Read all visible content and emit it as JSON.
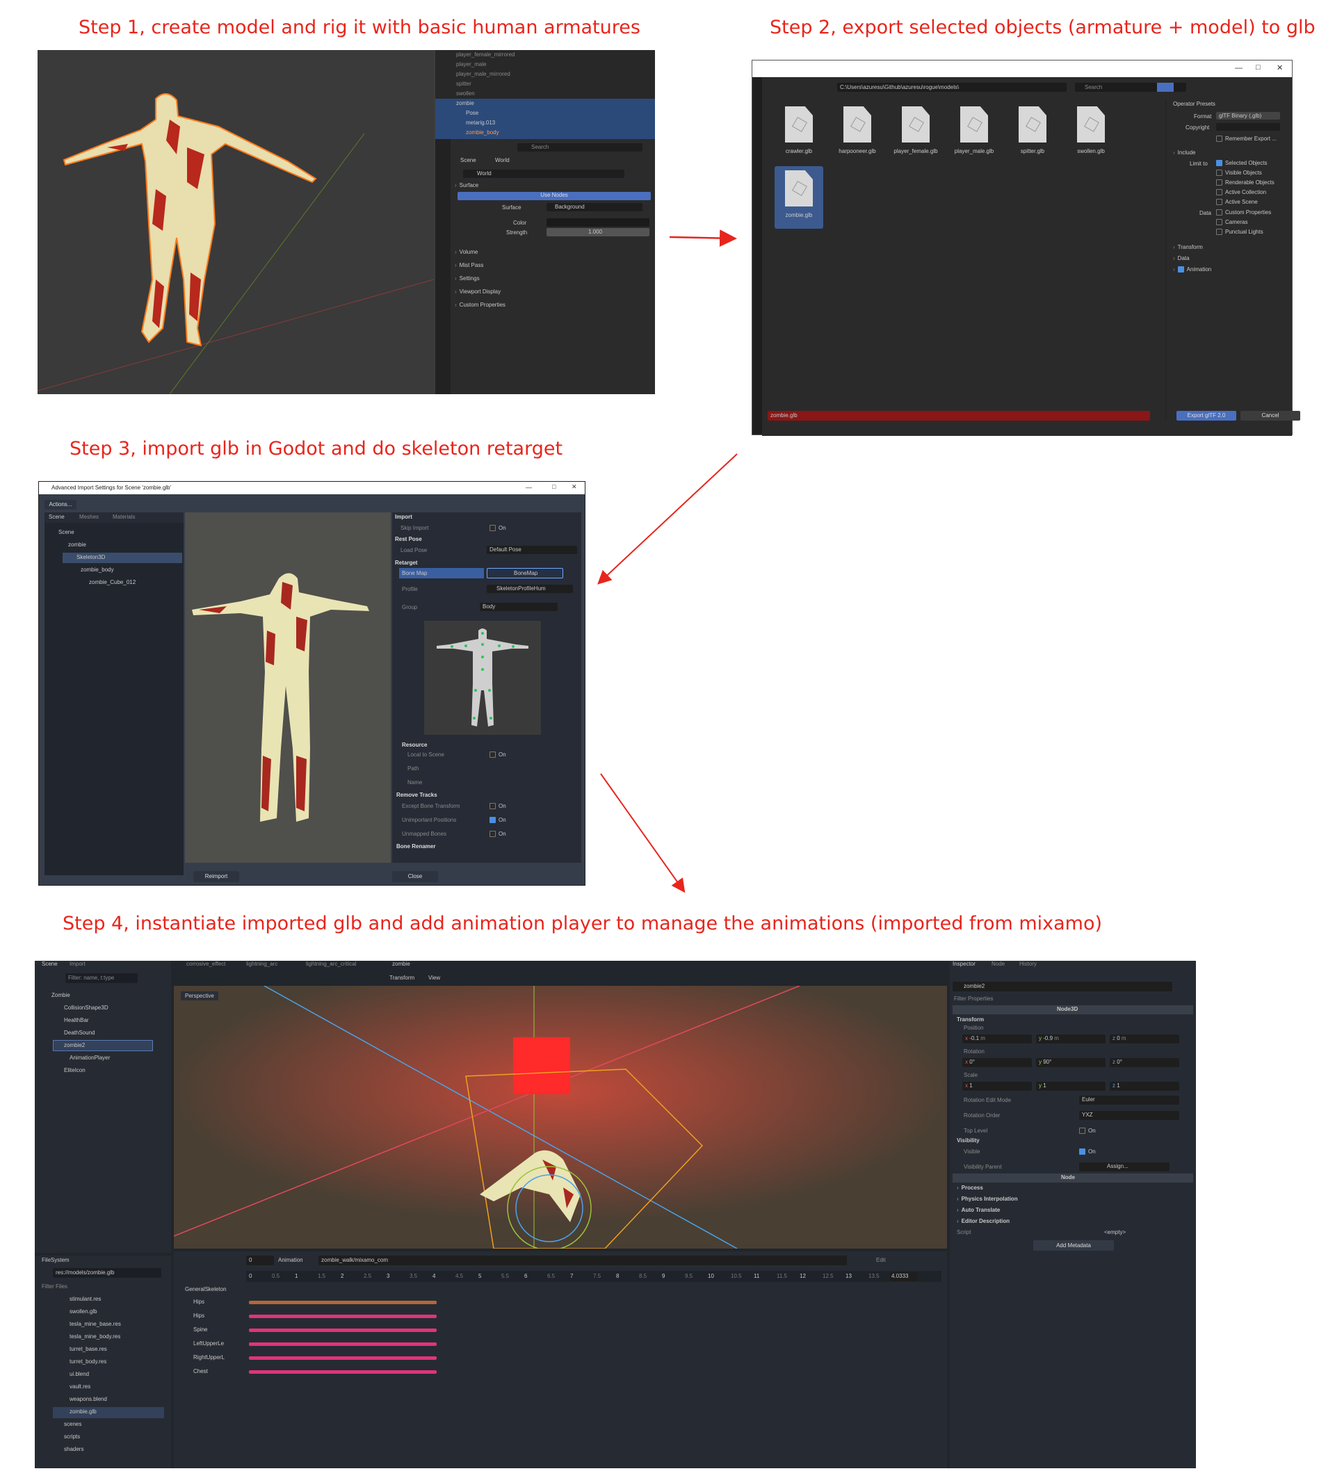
{
  "steps": {
    "s1": "Step 1, create model and rig it with basic human armatures",
    "s2": "Step 2, export selected objects (armature + model) to glb",
    "s3": "Step 3, import glb in Godot and do skeleton retarget",
    "s4": "Step 4, instantiate imported glb and add animation player to manage the animations (imported from mixamo)"
  },
  "colors": {
    "annotation": "#e8251c",
    "accent": "#4a90e2",
    "selection": "#2b4a7a"
  },
  "blender": {
    "outliner": [
      "player_female_mirrored",
      "player_male",
      "player_male_mirrored",
      "spitter",
      "swollen",
      "zombie",
      "Pose",
      "metarig.013",
      "zombie_body"
    ],
    "search_placeholder": "Search",
    "breadcrumb": [
      "Scene",
      "World"
    ],
    "world_name": "World",
    "surface_label": "Surface",
    "use_nodes": "Use Nodes",
    "surface_field": "Surface",
    "surface_value": "Background",
    "color_label": "Color",
    "strength_label": "Strength",
    "strength_value": "1.000",
    "panels": [
      "Volume",
      "Mist Pass",
      "Settings",
      "Viewport Display",
      "Custom Properties"
    ]
  },
  "export": {
    "path": "C:\\Users\\azuresu\\Github\\azuresu\\rogue\\models\\",
    "search": "Search",
    "files": [
      "crawler.glb",
      "harpooneer.glb",
      "player_female.glb",
      "player_male.glb",
      "spitter.glb",
      "swollen.glb",
      "zombie.glb"
    ],
    "operator_presets": "Operator Presets",
    "format_label": "Format",
    "format_value": "glTF Binary (.glb)",
    "copyright_label": "Copyright",
    "remember": "Remember Export ...",
    "include": "Include",
    "limit_to": "Limit to",
    "limit_opts": [
      {
        "label": "Selected Objects",
        "on": true
      },
      {
        "label": "Visible Objects",
        "on": false
      },
      {
        "label": "Renderable Objects",
        "on": false
      },
      {
        "label": "Active Collection",
        "on": false
      },
      {
        "label": "Active Scene",
        "on": false
      }
    ],
    "data_label": "Data",
    "data_opts": [
      {
        "label": "Custom Properties",
        "on": false
      },
      {
        "label": "Cameras",
        "on": false
      },
      {
        "label": "Punctual Lights",
        "on": false
      }
    ],
    "sections": [
      "Transform",
      "Data",
      "Animation"
    ],
    "filename": "zombie.glb",
    "export_btn": "Export glTF 2.0",
    "cancel_btn": "Cancel"
  },
  "import": {
    "title": "Advanced Import Settings for Scene 'zombie.glb'",
    "actions": "Actions...",
    "tabs": [
      "Scene",
      "Meshes",
      "Materials"
    ],
    "tree": [
      "Scene",
      "zombie",
      "Skeleton3D",
      "zombie_body",
      "zombie_Cube_012"
    ],
    "import_hdr": "Import",
    "skip_import": "Skip Import",
    "on": "On",
    "rest_pose": "Rest Pose",
    "load_pose": "Load Pose",
    "load_pose_val": "Default Pose",
    "retarget": "Retarget",
    "bone_map": "Bone Map",
    "bone_map_val": "BoneMap",
    "profile": "Profile",
    "profile_val": "SkeletonProfileHum",
    "group": "Group",
    "group_val": "Body",
    "resource": "Resource",
    "local_to_scene": "Local to Scene",
    "path": "Path",
    "name": "Name",
    "remove_tracks": "Remove Tracks",
    "except_bone": "Except Bone Transform",
    "unimportant": "Unimportant Positions",
    "unmapped": "Unmapped Bones",
    "bone_renamer": "Bone Renamer",
    "reimport": "Reimport",
    "close": "Close"
  },
  "godot": {
    "left_tabs": [
      "Scene",
      "Import"
    ],
    "filter_placeholder": "Filter: name, t:type",
    "scene_tree": [
      "Zombie",
      "CollisionShape3D",
      "HealthBar",
      "DeathSound",
      "zombie2",
      "AnimationPlayer",
      "EliteIcon"
    ],
    "editor_tabs": [
      "corrosive_effect",
      "lightning_arc",
      "lightning_arc_critical",
      "zombie"
    ],
    "toolbar_menus": [
      "Transform",
      "View"
    ],
    "perspective": "Perspective",
    "filesystem": "FileSystem",
    "fs_path": "res://models/zombie.glb",
    "fs_filter": "Filter Files",
    "files": [
      "stimulant.res",
      "swollen.glb",
      "tesla_mine_base.res",
      "tesla_mine_body.res",
      "turret_base.res",
      "turret_body.res",
      "ui.blend",
      "vault.res",
      "weapons.blend",
      "zombie.glb"
    ],
    "folders": [
      "scenes",
      "scripts",
      "shaders"
    ],
    "anim_label": "Animation",
    "anim_name": "zombie_walk/mixamo_com",
    "anim_edit": "Edit",
    "time_value": "0",
    "anim_length": "4.0333",
    "ticks": [
      "0",
      "0.5",
      "1",
      "1.5",
      "2",
      "2.5",
      "3",
      "3.5",
      "4",
      "4.5",
      "5",
      "5.5",
      "6",
      "6.5",
      "7",
      "7.5",
      "8",
      "8.5",
      "9",
      "9.5",
      "10",
      "10.5",
      "11",
      "11.5",
      "12",
      "12.5",
      "13",
      "13.5"
    ],
    "skeleton": "GeneralSkeleton",
    "tracks": [
      "Hips",
      "Hips",
      "Spine",
      "LeftUpperLe",
      "RightUpperL",
      "Chest"
    ],
    "inspector_tabs": [
      "Inspector",
      "Node",
      "History"
    ],
    "node_name": "zombie2",
    "filter_props": "Filter Properties",
    "node3d": "Node3D",
    "transform": "Transform",
    "position": "Position",
    "pos": [
      "-0.1",
      "-0.9",
      "0"
    ],
    "pos_unit": "m",
    "rotation": "Rotation",
    "rot": [
      "0",
      "90",
      "0"
    ],
    "deg": "°",
    "scale": "Scale",
    "scl": [
      "1",
      "1",
      "1"
    ],
    "axes": [
      "x",
      "y",
      "z"
    ],
    "rot_edit_mode": "Rotation Edit Mode",
    "rot_edit_val": "Euler",
    "rot_order": "Rotation Order",
    "rot_order_val": "YXZ",
    "top_level": "Top Level",
    "on": "On",
    "visibility": "Visibility",
    "visible": "Visible",
    "vis_parent": "Visibility Parent",
    "assign": "Assign...",
    "node": "Node",
    "node_sections": [
      "Process",
      "Physics Interpolation",
      "Auto Translate",
      "Editor Description"
    ],
    "script": "Script",
    "script_val": "<empty>",
    "add_metadata": "Add Metadata"
  }
}
